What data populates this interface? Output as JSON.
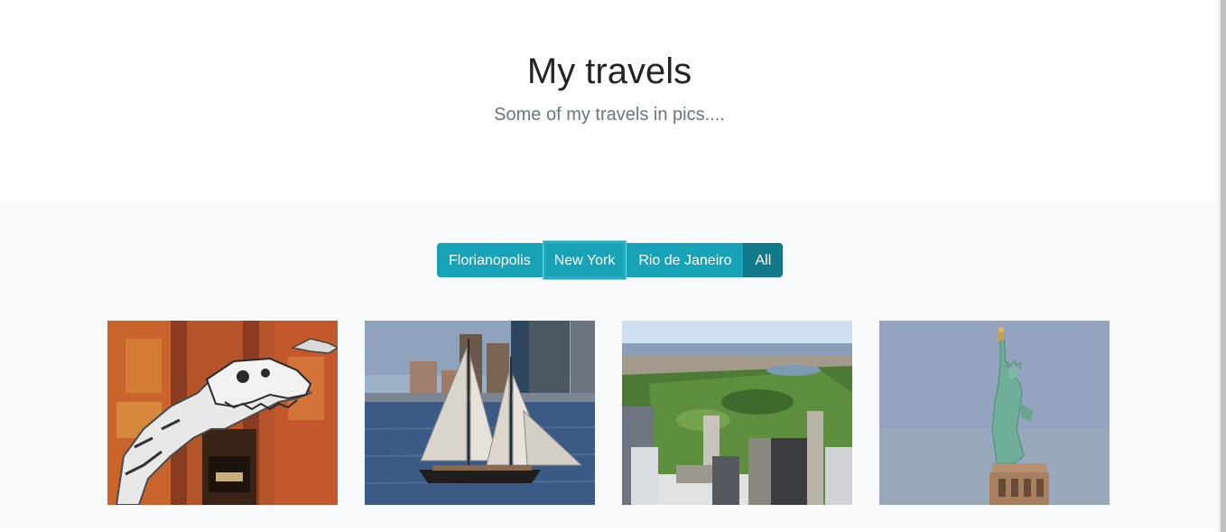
{
  "header": {
    "title": "My travels",
    "subtitle": "Some of my travels in pics...."
  },
  "filters": {
    "buttons": [
      {
        "label": "Florianopolis"
      },
      {
        "label": "New York"
      },
      {
        "label": "Rio de Janeiro"
      },
      {
        "label": "All"
      }
    ],
    "focused": "New York",
    "active": "All"
  },
  "gallery": {
    "photos": [
      {
        "subject": "dinosaur-skeleton"
      },
      {
        "subject": "sailing-ship"
      },
      {
        "subject": "central-park"
      },
      {
        "subject": "statue-of-liberty"
      }
    ]
  },
  "colors": {
    "button": "#17a2b8",
    "button_active": "#117a8b",
    "title": "#212529",
    "subtitle": "#6c757d",
    "album_bg": "#f8f9fa"
  }
}
